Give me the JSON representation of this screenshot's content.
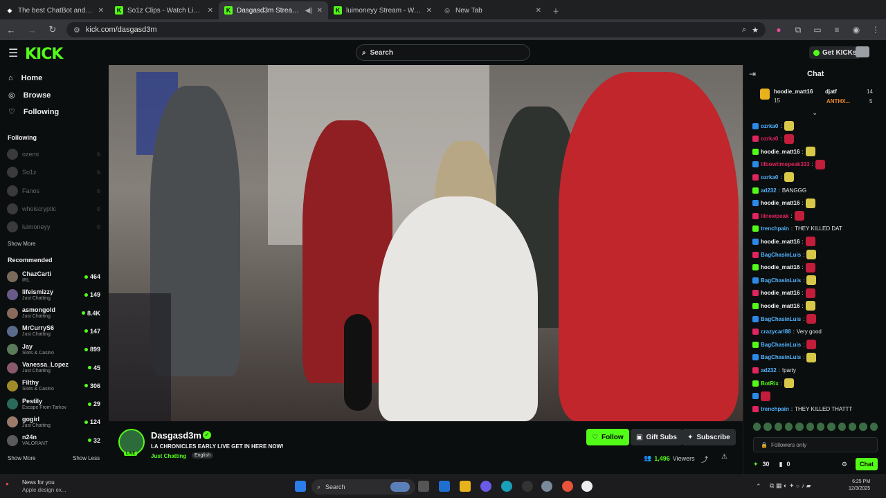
{
  "browser": {
    "tabs": [
      {
        "label": "The best ChatBot and Widgets",
        "icon": "streamelements-icon"
      },
      {
        "label": "So1z Clips - Watch Live on Kick",
        "icon": "kick-icon"
      },
      {
        "label": "Dasgasd3m Stream - Watch",
        "icon": "kick-icon",
        "active": true
      },
      {
        "label": "luimoneyy Stream - Watch Live",
        "icon": "kick-icon"
      },
      {
        "label": "New Tab",
        "icon": "globe-icon"
      }
    ],
    "url": "kick.com/dasgasd3m"
  },
  "header": {
    "logo": "KICK",
    "search_placeholder": "Search",
    "get_kicks": "Get KICKs"
  },
  "sidebar": {
    "nav": [
      "Home",
      "Browse",
      "Following"
    ],
    "following_heading": "Following",
    "following": [
      "ozemi",
      "So1z",
      "Fanos",
      "whoiscryptic",
      "luimoneyy"
    ],
    "show_more_following": "Show More",
    "recommended_heading": "Recommended",
    "recommended": [
      {
        "name": "ChazCarti",
        "category": "IRL",
        "viewers": "464",
        "color": "#7a6a5a"
      },
      {
        "name": "lifeismizzy",
        "category": "Just Chatting",
        "viewers": "149",
        "color": "#6a5a8a"
      },
      {
        "name": "asmongold",
        "category": "Just Chatting",
        "viewers": "8.4K",
        "color": "#8a6a5a"
      },
      {
        "name": "MrCurryS6",
        "category": "Just Chatting",
        "viewers": "147",
        "color": "#5a6a8a"
      },
      {
        "name": "Jay",
        "category": "Slots & Casino",
        "viewers": "899",
        "color": "#5a7a5a"
      },
      {
        "name": "Vanessa_Lopez",
        "category": "Just Chatting",
        "viewers": "45",
        "color": "#8a5a6a"
      },
      {
        "name": "Filthy",
        "category": "Slots & Casino",
        "viewers": "306",
        "color": "#a08a2a"
      },
      {
        "name": "Pestily",
        "category": "Escape From Tarkov",
        "viewers": "29",
        "color": "#2a6a5a"
      },
      {
        "name": "gogirl",
        "category": "Just Chatting",
        "viewers": "124",
        "color": "#9a7a6a"
      },
      {
        "name": "n24n",
        "category": "VALORANT",
        "viewers": "32",
        "color": "#5a5a5a"
      }
    ],
    "show_more": "Show More",
    "show_less": "Show Less"
  },
  "stream": {
    "streamer": "Dasgasd3m",
    "live_badge": "LIVE",
    "title": "LA CHRONICLES EARLY LIVE GET IN HERE NOW!",
    "category": "Just Chatting",
    "language": "English",
    "follow": "Follow",
    "gift_subs": "Gift Subs",
    "subscribe": "Subscribe",
    "viewers_count": "1,496",
    "viewers_label": "Viewers"
  },
  "chat": {
    "heading": "Chat",
    "pinned": [
      {
        "user": "hoodie_matt16",
        "count": "15"
      },
      {
        "user": "djatf",
        "count": "14"
      },
      {
        "user": "ANTHX...",
        "count": "5"
      }
    ],
    "messages": [
      {
        "user": "ozrka0",
        "text": "",
        "color": "#53b4ff",
        "emote": true
      },
      {
        "user": "ozrka0",
        "text": "",
        "color": "#e0245e",
        "emote": true
      },
      {
        "user": "hoodie_matt16",
        "text": "",
        "color": "#f5f5f5",
        "emote": true
      },
      {
        "user": "lilbowtimepeak333",
        "text": "",
        "color": "#e0245e",
        "emote": true
      },
      {
        "user": "ozrka0",
        "text": "",
        "color": "#53b4ff",
        "emote": true
      },
      {
        "user": "ad232",
        "text": "BANGGG",
        "color": "#53b4ff",
        "emote": false
      },
      {
        "user": "hoodie_matt16",
        "text": "",
        "color": "#f5f5f5",
        "emote": true
      },
      {
        "user": "lilnewpeak",
        "text": "",
        "color": "#e0245e",
        "emote": true
      },
      {
        "user": "trenchpain",
        "text": "THEY KILLED DAT",
        "color": "#53b4ff",
        "emote": false
      },
      {
        "user": "hoodie_matt16",
        "text": "",
        "color": "#f5f5f5",
        "emote": true
      },
      {
        "user": "BagChasinLuis",
        "text": "",
        "color": "#53b4ff",
        "emote": true
      },
      {
        "user": "hoodie_matt16",
        "text": "",
        "color": "#f5f5f5",
        "emote": true
      },
      {
        "user": "BagChasinLuis",
        "text": "",
        "color": "#53b4ff",
        "emote": true
      },
      {
        "user": "hoodie_matt16",
        "text": "",
        "color": "#f5f5f5",
        "emote": true
      },
      {
        "user": "hoodie_matt16",
        "text": "",
        "color": "#f5f5f5",
        "emote": true
      },
      {
        "user": "BagChasinLuis",
        "text": "",
        "color": "#53b4ff",
        "emote": true
      },
      {
        "user": "crazycarl88",
        "text": "Very good",
        "color": "#53b4ff",
        "emote": false
      },
      {
        "user": "BagChasinLuis",
        "text": "",
        "color": "#53b4ff",
        "emote": true
      },
      {
        "user": "BagChasinLuis",
        "text": "",
        "color": "#53b4ff",
        "emote": true
      },
      {
        "user": "ad232",
        "text": "!party",
        "color": "#53b4ff",
        "emote": false
      },
      {
        "user": "BotRix",
        "text": "",
        "color": "#53fc18",
        "emote": true
      },
      {
        "user": "",
        "text": "",
        "color": "#f5f5f5",
        "emote": true
      },
      {
        "user": "trenchpain",
        "text": "THEY KILLED THATTT",
        "color": "#53b4ff",
        "emote": false
      }
    ],
    "input_placeholder": "Followers only",
    "kicks_count": "30",
    "count_two": "0",
    "chat_button": "Chat"
  },
  "taskbar": {
    "news_title": "News for you",
    "news_sub": "Apple design ex...",
    "search": "Search",
    "time": "6:25 PM",
    "date": "12/3/2025"
  },
  "colors": {
    "accent": "#53fc18",
    "bg": "#0b0e0f"
  }
}
